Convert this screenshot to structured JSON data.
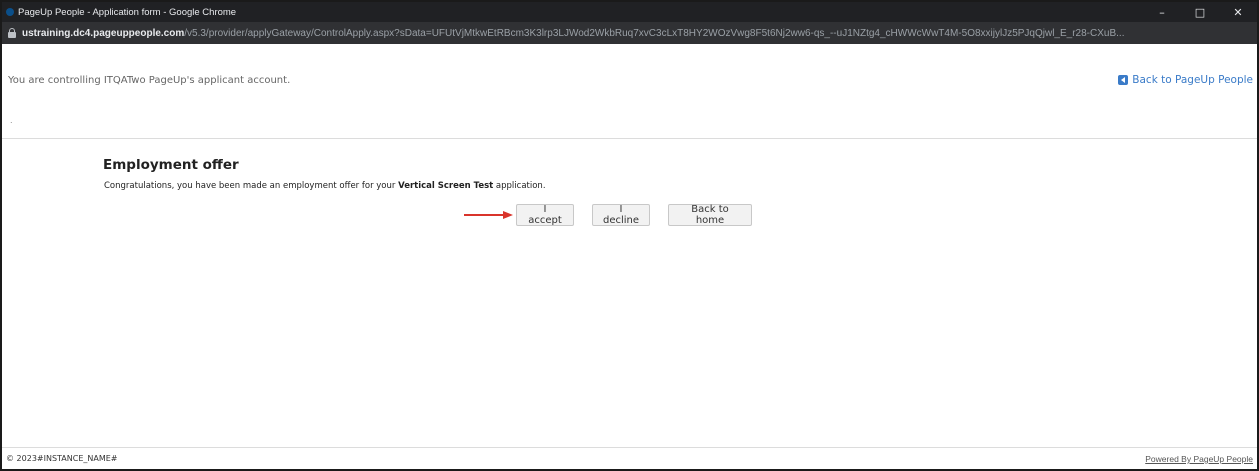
{
  "window": {
    "title": "PageUp People - Application form - Google Chrome",
    "controls": {
      "minimize": "–",
      "maximize": "□",
      "close": "✕"
    }
  },
  "address": {
    "host": "ustraining.dc4.pageuppeople.com",
    "path": "/v5.3/provider/applyGateway/ControlApply.aspx?sData=UFUtVjMtkwEtRBcm3K3lrp3LJWod2WkbRuq7xvC3cLxT8HY2WOzVwg8F5t6Nj2ww6-qs_--uJ1NZtg4_cHWWcWwT4M-5O8xxijylJz5PJqQjwl_E_r28-CXuB..."
  },
  "notice": {
    "text": "You are controlling ITQATwo PageUp's applicant account.",
    "dot": ".",
    "back_link": "Back to PageUp People"
  },
  "offer": {
    "heading": "Employment offer",
    "message_prefix": "Congratulations, you have been made an employment offer for your ",
    "job_title": "Vertical Screen Test",
    "message_suffix": " application.",
    "accept_label": "I accept",
    "decline_label": "I decline",
    "home_label": "Back to home"
  },
  "footer": {
    "copyright": "© 2023#INSTANCE_NAME#",
    "powered_by": "Powered By PageUp People"
  },
  "colors": {
    "link": "#3a7bc8",
    "annotation_arrow": "#d9342b"
  }
}
